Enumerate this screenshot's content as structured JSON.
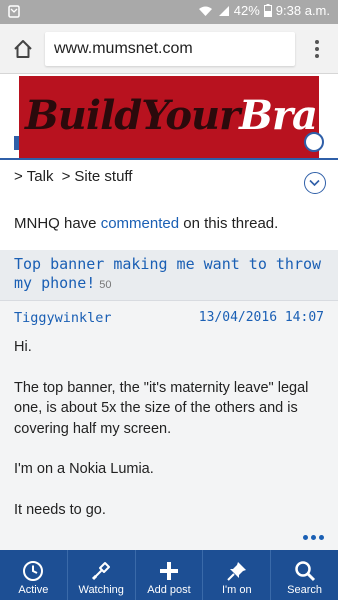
{
  "status_bar": {
    "battery": "42%",
    "time": "9:38 a.m."
  },
  "browser": {
    "url": "www.mumsnet.com"
  },
  "ad": {
    "text_part1": "BuildYour",
    "text_part2": "Brand"
  },
  "breadcrumb": {
    "items": [
      "Talk",
      "Site stuff"
    ]
  },
  "notice": {
    "prefix": "MNHQ have ",
    "link": "commented",
    "suffix": " on this thread."
  },
  "thread": {
    "title": "Top banner making me want to throw my phone!",
    "count": "50"
  },
  "post": {
    "author": "Tiggywinkler",
    "date": "13/04/2016 14:07",
    "paragraphs": [
      "Hi.",
      "The top banner, the \"it's maternity leave\" legal one, is about 5x the size of the others and is covering half my screen.",
      "I'm on a Nokia Lumia.",
      "It needs to go."
    ]
  },
  "bottom_nav": {
    "items": [
      {
        "label": "Active",
        "icon": "clock-icon"
      },
      {
        "label": "Watching",
        "icon": "flashlight-icon"
      },
      {
        "label": "Add post",
        "icon": "plus-icon"
      },
      {
        "label": "I'm on",
        "icon": "pin-icon"
      },
      {
        "label": "Search",
        "icon": "search-icon"
      }
    ]
  },
  "colors": {
    "link": "#1a5fb4",
    "nav_bg": "#1d4f94",
    "ad_bg": "#b8121f"
  }
}
